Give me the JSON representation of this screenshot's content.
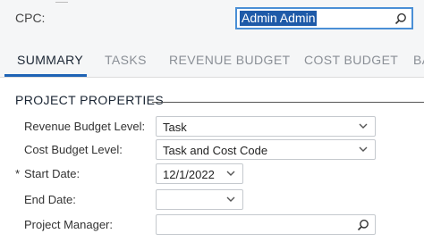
{
  "cpc": {
    "label": "CPC:",
    "value": "Admin Admin"
  },
  "tabs": [
    {
      "label": "SUMMARY"
    },
    {
      "label": "TASKS"
    },
    {
      "label": "REVENUE BUDGET"
    },
    {
      "label": "COST BUDGET"
    },
    {
      "label": "BA"
    }
  ],
  "active_tab": "SUMMARY",
  "section": {
    "title": "PROJECT PROPERTIES"
  },
  "fields": {
    "revenue_budget_level": {
      "label": "Revenue Budget Level:",
      "value": "Task"
    },
    "cost_budget_level": {
      "label": "Cost Budget Level:",
      "value": "Task and Cost Code"
    },
    "start_date": {
      "required_mark": "*",
      "label": "Start Date:",
      "value": "12/1/2022"
    },
    "end_date": {
      "label": "End Date:",
      "value": ""
    },
    "project_manager": {
      "label": "Project Manager:",
      "value": ""
    }
  },
  "colors": {
    "accent": "#1e63b5",
    "selection": "#1e5aa8",
    "header_bg": "#f5f6f7"
  }
}
